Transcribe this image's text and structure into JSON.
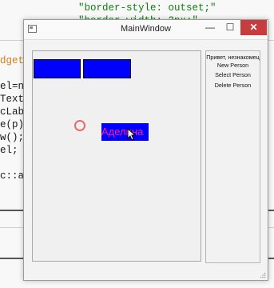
{
  "editor": {
    "lines": [
      {
        "text": "\"border-style: outset;\""
      },
      {
        "text": "\"border-width: 2px;\""
      }
    ],
    "left_fragments": [
      "dget",
      "el=n",
      "Text",
      "cLab",
      "e(p)",
      "w();",
      "el;",
      "c::a"
    ]
  },
  "window": {
    "title": "MainWindow",
    "buttons": {
      "minimize": "—",
      "maximize": "☐",
      "close": "✕"
    }
  },
  "canvas": {
    "label_text": "Аделина"
  },
  "side_panel": {
    "greeting": "Привет, незнакомец",
    "items": [
      "New Person",
      "Select Person",
      "Delete Person"
    ]
  }
}
